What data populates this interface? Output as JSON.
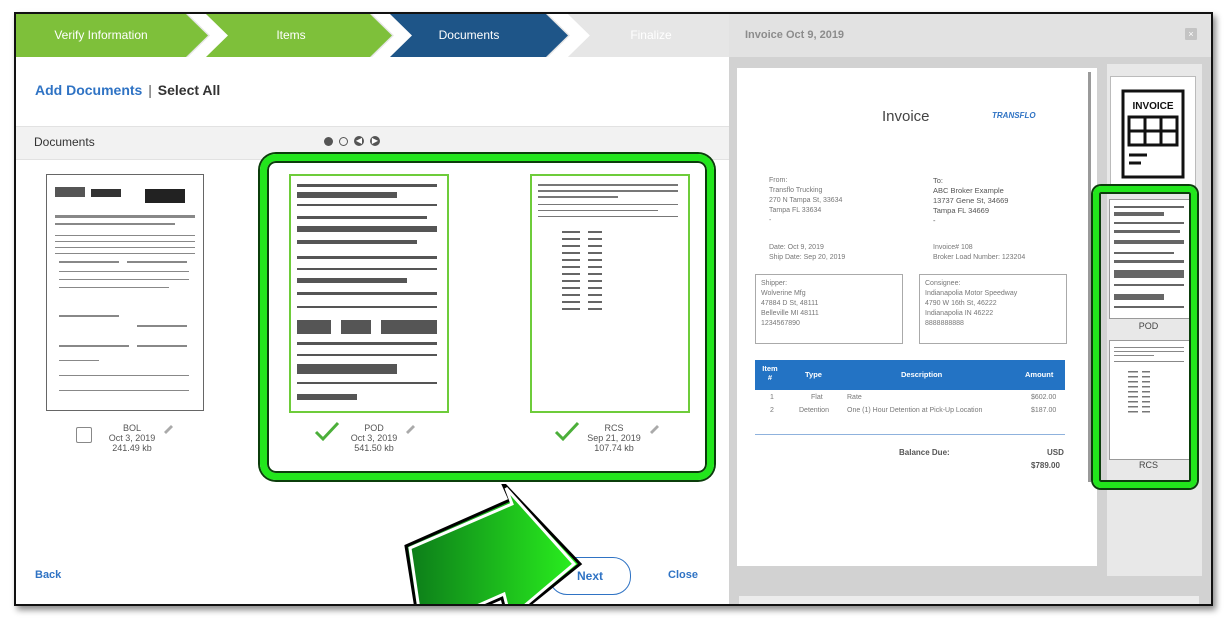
{
  "wizard": {
    "steps": [
      {
        "label": "Verify Information",
        "state": "complete"
      },
      {
        "label": "Items",
        "state": "complete"
      },
      {
        "label": "Documents",
        "state": "active"
      },
      {
        "label": "Finalize",
        "state": "pending"
      }
    ],
    "colors": {
      "complete": "#7ec03a",
      "active": "#1e5588",
      "pending": "#e6e6e6",
      "link": "#2f73c4",
      "highlight": "#22e61c"
    }
  },
  "toolbar": {
    "add_documents": "Add Documents",
    "separator": "|",
    "select_all": "Select All"
  },
  "documents_bar": {
    "title": "Documents"
  },
  "documents": [
    {
      "name": "BOL",
      "date": "Oct 3, 2019",
      "size": "241.49 kb",
      "checked": false
    },
    {
      "name": "POD",
      "date": "Oct 3, 2019",
      "size": "541.50 kb",
      "checked": true
    },
    {
      "name": "RCS",
      "date": "Sep 21, 2019",
      "size": "107.74 kb",
      "checked": true
    }
  ],
  "footer": {
    "back": "Back",
    "next": "Next",
    "close": "Close"
  },
  "preview": {
    "header": "Invoice  Oct 9, 2019",
    "close_icon": "×",
    "invoice": {
      "title": "Invoice",
      "logo": "TRANSFLO",
      "from_label": "From:",
      "from_name": "Transflo Trucking",
      "from_addr1": "270 N Tampa St, 33634",
      "from_addr2": "Tampa FL 33634",
      "from_dash": "-",
      "to_label": "To:",
      "to_name": "ABC Broker Example",
      "to_addr1": "13737 Gene St, 34669",
      "to_addr2": "Tampa FL 34669",
      "to_dash": "-",
      "date": "Date: Oct 9, 2019",
      "ship_date": "Ship Date: Sep 20, 2019",
      "invoice_no": "Invoice# 108",
      "broker_load": "Broker Load Number: 123204",
      "shipper_label": "Shipper:",
      "shipper_name": "Wolverine Mfg",
      "shipper_addr1": "47884 D St, 48111",
      "shipper_addr2": "Belleville MI 48111",
      "shipper_phone": "1234567890",
      "consignee_label": "Consignee:",
      "consignee_name": "Indianapolia Motor Speedway",
      "consignee_addr1": "4790 W 16th St, 46222",
      "consignee_addr2": "Indianapolia IN 46222",
      "consignee_phone": "8888888888",
      "columns": {
        "item": "Item #",
        "type": "Type",
        "description": "Description",
        "amount": "Amount"
      },
      "lines": [
        {
          "item": "1",
          "type": "Flat",
          "description": "Rate",
          "amount": "$602.00"
        },
        {
          "item": "2",
          "type": "Detention",
          "description": "One (1) Hour Detention at Pick-Up Location",
          "amount": "$187.00"
        }
      ],
      "balance_label": "Balance Due:",
      "currency": "USD",
      "balance": "$789.00"
    },
    "side_invoice_label": "INVOICE",
    "side_docs": [
      {
        "label": "POD"
      },
      {
        "label": "RCS"
      }
    ]
  }
}
